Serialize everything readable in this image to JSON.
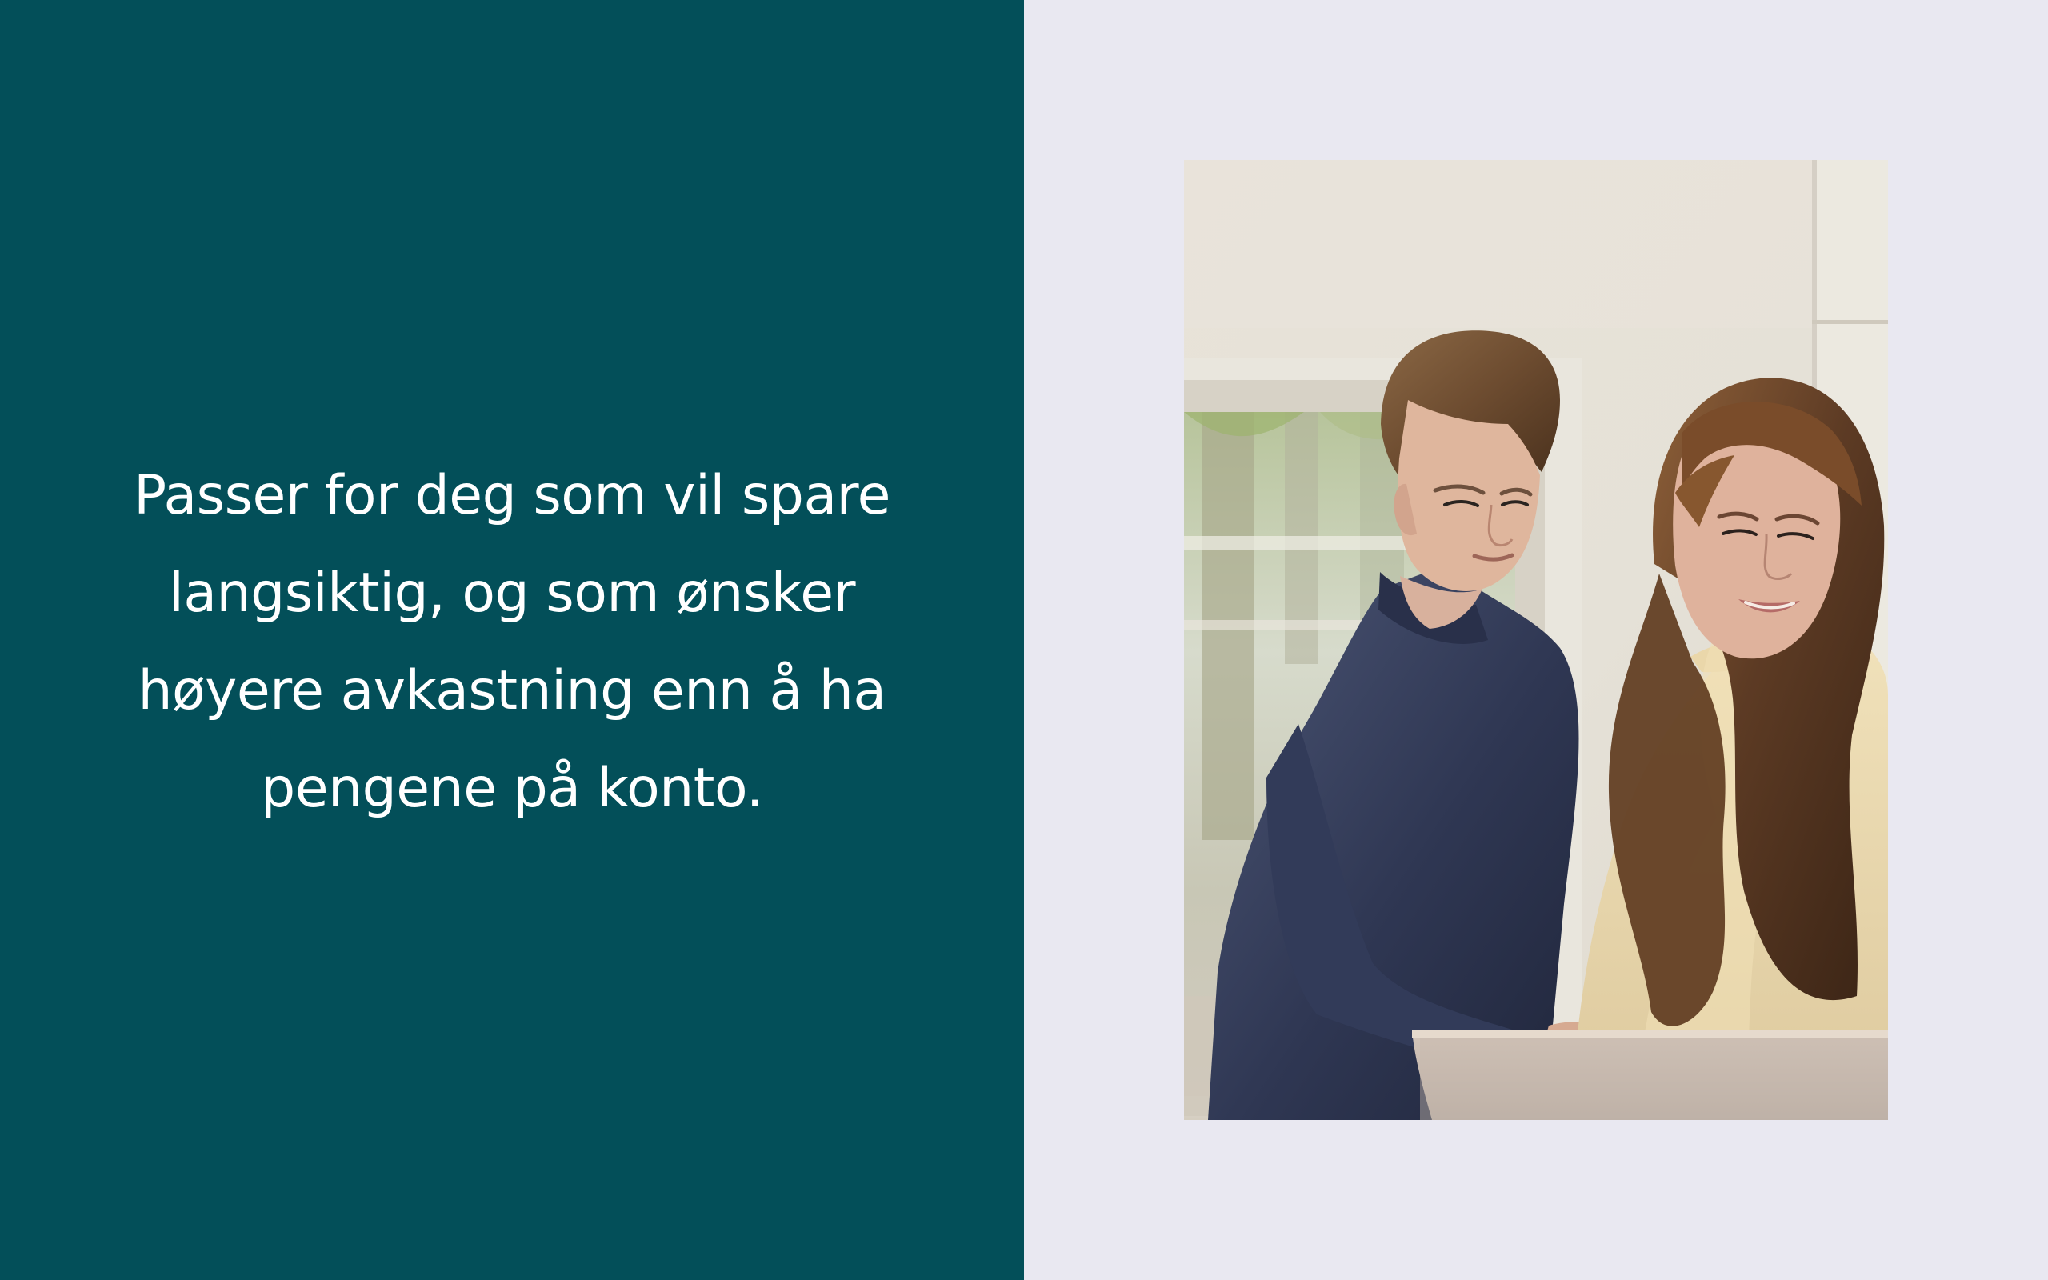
{
  "slide": {
    "headline": "Passer for deg som vil spare langsiktig, og som ønsker høyere avkastning enn å ha pengene på konto.",
    "colors": {
      "left_panel": "#034f59",
      "right_panel": "#e9e8f1",
      "text": "#ffffff"
    }
  },
  "photo": {
    "subject": "photo-of-couple-using-laptop"
  }
}
